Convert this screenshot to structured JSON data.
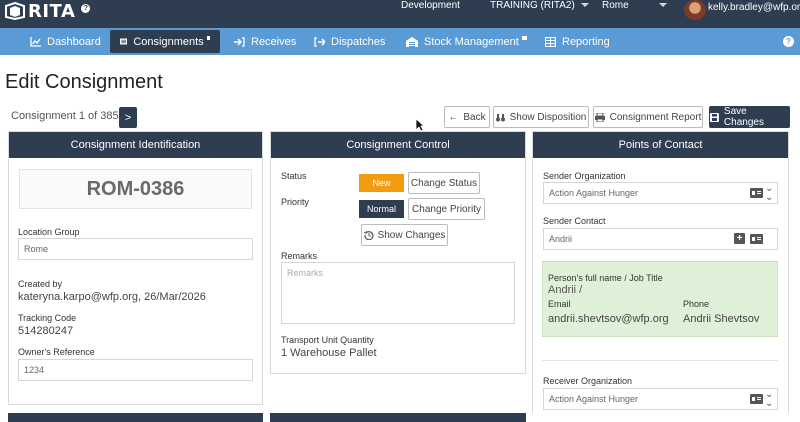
{
  "topbar": {
    "logo_text": "RITA",
    "environment": "Development",
    "training": "TRAINING (RITA2)",
    "location": "Rome",
    "user_email": "kelly.bradley@wfp.org"
  },
  "nav": {
    "items": [
      {
        "label": "Dashboard",
        "icon": "chart-icon"
      },
      {
        "label": "Consignments",
        "icon": "list-icon"
      },
      {
        "label": "Receives",
        "icon": "sign-in-icon"
      },
      {
        "label": "Dispatches",
        "icon": "sign-out-icon"
      },
      {
        "label": "Stock Management",
        "icon": "warehouse-icon"
      },
      {
        "label": "Reporting",
        "icon": "table-icon"
      }
    ],
    "help": "?"
  },
  "page": {
    "title": "Edit Consignment",
    "counter": "Consignment 1 of 385",
    "next_label": ">"
  },
  "toolbar": {
    "back": "Back",
    "show_disposition": "Show Disposition",
    "consignment_report": "Consignment Report",
    "save_changes": "Save Changes"
  },
  "identification": {
    "heading": "Consignment Identification",
    "code": "ROM-0386",
    "location_group_label": "Location Group",
    "location_group_value": "Rome",
    "created_by_label": "Created by",
    "created_by_value": "kateryna.karpo@wfp.org, 26/Mar/2026",
    "tracking_code_label": "Tracking Code",
    "tracking_code_value": "514280247",
    "owners_reference_label": "Owner's Reference",
    "owners_reference_value": "1234"
  },
  "control": {
    "heading": "Consignment Control",
    "status_label": "Status",
    "status_value": "New",
    "change_status": "Change Status",
    "priority_label": "Priority",
    "priority_value": "Normal",
    "change_priority": "Change Priority",
    "show_changes": "Show Changes",
    "remarks_label": "Remarks",
    "remarks_placeholder": "Remarks",
    "tuq_label": "Transport Unit Quantity",
    "tuq_value": "1 Warehouse Pallet"
  },
  "contacts": {
    "heading": "Points of Contact",
    "sender_org_label": "Sender Organization",
    "sender_org_value": "Action Against Hunger",
    "sender_contact_label": "Sender Contact",
    "sender_contact_value": "Andrii",
    "full_name_label": "Person's full name / Job Title",
    "full_name_value": "Andrii /",
    "email_label": "Email",
    "email_value": "andrii.shevtsov@wfp.org",
    "phone_label": "Phone",
    "phone_value": "Andrii Shevtsov",
    "receiver_org_label": "Receiver Organization",
    "receiver_org_value": "Action Against Hunger"
  },
  "colors": {
    "dark": "#2e3e50",
    "nav": "#5b9bd5",
    "status_new": "#f39c12",
    "contact_bg": "#dff0d8"
  }
}
